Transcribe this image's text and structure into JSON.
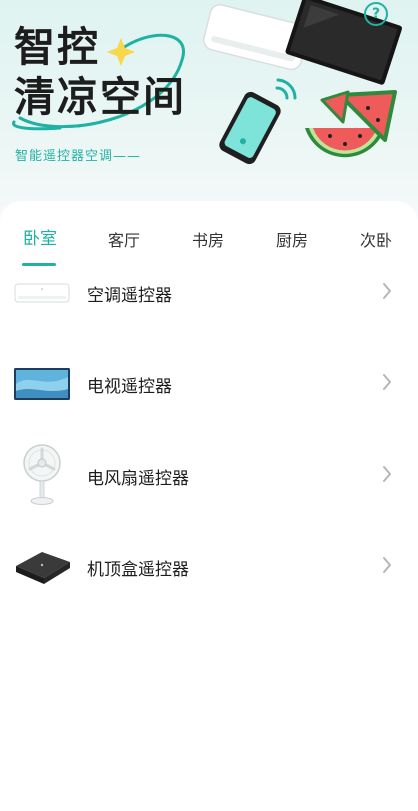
{
  "banner": {
    "title_line1": "智控",
    "title_line2": "清凉空间",
    "subtitle": "智能遥控器空调——"
  },
  "help_icon_glyph": "?",
  "tabs": [
    {
      "label": "卧室",
      "active": true
    },
    {
      "label": "客厅",
      "active": false
    },
    {
      "label": "书房",
      "active": false
    },
    {
      "label": "厨房",
      "active": false
    },
    {
      "label": "次卧",
      "active": false
    }
  ],
  "devices": [
    {
      "label": "空调遥控器",
      "icon": "air-conditioner-icon"
    },
    {
      "label": "电视遥控器",
      "icon": "tv-icon"
    },
    {
      "label": "电风扇遥控器",
      "icon": "fan-icon"
    },
    {
      "label": "机顶盒遥控器",
      "icon": "set-top-box-icon"
    }
  ],
  "colors": {
    "accent": "#1fb2a3",
    "text": "#1d1d1d",
    "chevron": "#b5b5b5"
  }
}
